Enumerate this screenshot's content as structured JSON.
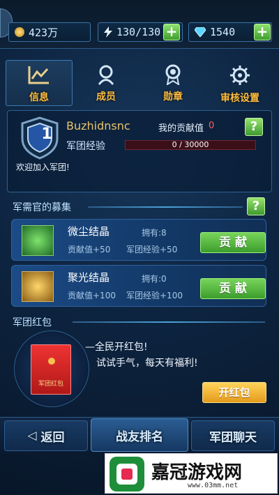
{
  "topbar": {
    "gold": "423万",
    "energy": "130/130",
    "gems": "1540",
    "icons": {
      "gold": "coin-icon",
      "energy": "lightning-icon",
      "gems": "diamond-icon",
      "add": "plus-icon"
    }
  },
  "tabs": [
    {
      "label": "信息",
      "icon": "chart-icon",
      "active": true
    },
    {
      "label": "成员",
      "icon": "member-icon",
      "active": false
    },
    {
      "label": "勋章",
      "icon": "medal-icon",
      "active": false
    },
    {
      "label": "审核设置",
      "icon": "gear-icon",
      "active": false
    }
  ],
  "legion": {
    "rank": "1",
    "name": "Buzhidnsnc",
    "contribution_label": "我的贡献值",
    "contribution_value": "0",
    "exp_label": "军团经验",
    "exp_text": "0 / 30000",
    "exp_progress": 0,
    "welcome": "欢迎加入军团!"
  },
  "recruit": {
    "title": "军需官的募集",
    "items": [
      {
        "name": "微尘结晶",
        "own": "拥有:8",
        "contrib": "贡献值+50",
        "exp": "军团经验+50",
        "button": "贡 献",
        "icon": "green-crystal-icon",
        "color": "#45b43d"
      },
      {
        "name": "聚光结晶",
        "own": "拥有:0",
        "contrib": "贡献值+100",
        "exp": "军团经验+100",
        "button": "贡 献",
        "icon": "gold-crystal-icon",
        "color": "#d9b04a"
      }
    ]
  },
  "redpack": {
    "title": "军团红包",
    "envelope_label": "军团红包",
    "line1": "全民开红包!",
    "line2": "试试手气，每天有福利!",
    "button": "开红包"
  },
  "bottom_nav": {
    "back": "返回",
    "rank": "战友排名",
    "chat": "军团聊天"
  },
  "watermark": {
    "site_name": "嘉冠游戏网",
    "url": "www.03mm.net"
  }
}
